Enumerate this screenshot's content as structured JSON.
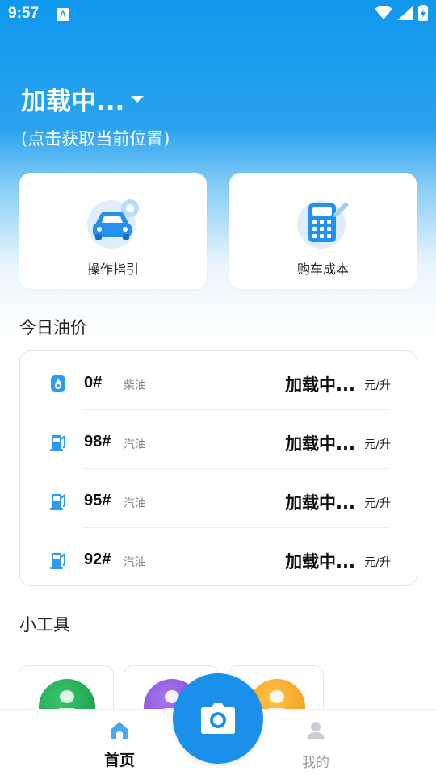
{
  "status_bar": {
    "time": "9:57",
    "notification_badge": "A"
  },
  "location": {
    "title": "加载中...",
    "hint": "(点击获取当前位置)"
  },
  "quick_actions": [
    {
      "label": "操作指引",
      "icon": "car-icon"
    },
    {
      "label": "购车成本",
      "icon": "calculator-icon"
    }
  ],
  "sections": {
    "oil_price_title": "今日油价",
    "tools_title": "小工具"
  },
  "oil_prices": [
    {
      "grade": "0#",
      "type": "柴油",
      "price": "加载中...",
      "unit": "元/升",
      "icon": "oil-drop-icon"
    },
    {
      "grade": "98#",
      "type": "汽油",
      "price": "加载中...",
      "unit": "元/升",
      "icon": "fuel-pump-icon"
    },
    {
      "grade": "95#",
      "type": "汽油",
      "price": "加载中...",
      "unit": "元/升",
      "icon": "fuel-pump-icon"
    },
    {
      "grade": "92#",
      "type": "汽油",
      "price": "加载中...",
      "unit": "元/升",
      "icon": "fuel-pump-icon"
    }
  ],
  "tools": [
    {
      "icon": "car-check-icon",
      "color": "#1fa84f"
    },
    {
      "icon": "wrench-icon",
      "color": "#8a4fd8"
    },
    {
      "icon": "no-smoking-icon",
      "color": "#f0a020"
    }
  ],
  "tab_bar": {
    "home_label": "首页",
    "mine_label": "我的",
    "center_icon": "camera-icon"
  },
  "colors": {
    "accent": "#1b90ea",
    "hero_top": "#0f98ec"
  }
}
